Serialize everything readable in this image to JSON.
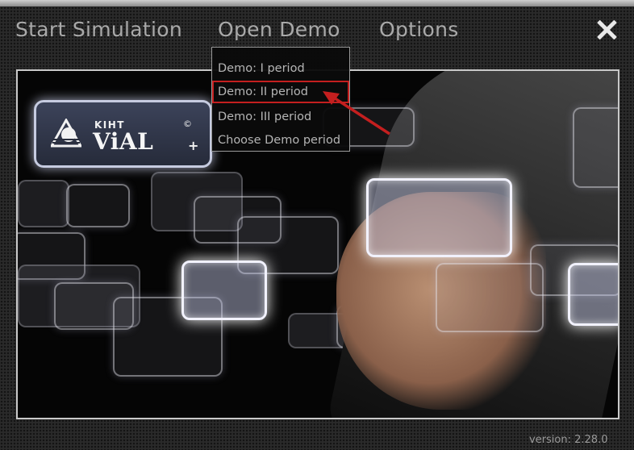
{
  "menu": {
    "start_label": "Start Simulation",
    "open_demo_label": "Open Demo",
    "options_label": "Options"
  },
  "dropdown": {
    "items": [
      {
        "label": "Demo: I period",
        "highlighted": false
      },
      {
        "label": "Demo: II period",
        "highlighted": true
      },
      {
        "label": "Demo: III period",
        "highlighted": false
      },
      {
        "label": "Choose Demo period",
        "highlighted": false
      }
    ]
  },
  "logo": {
    "kiht": "KIHT",
    "vial": "ViAL",
    "plus": "+",
    "copyright": "©"
  },
  "icons": {
    "close": "close-icon",
    "annotation": "red-arrow-icon",
    "logo_mark": "triangle-sphere-logo-icon"
  },
  "colors": {
    "highlight_border": "#c41f1f",
    "menu_text": "#a9a9a9",
    "background": "#2a2a2a"
  },
  "version": "version: 2.28.0"
}
